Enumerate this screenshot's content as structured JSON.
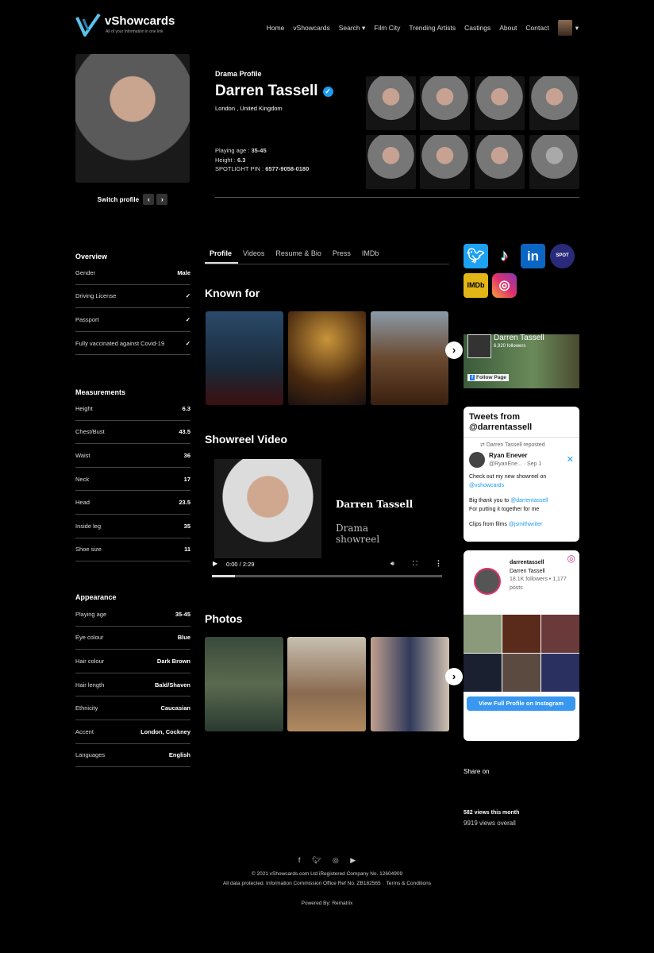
{
  "brand": {
    "name": "vShowcards",
    "tagline": "All of your Information in one link"
  },
  "nav": [
    "Home",
    "vShowcards",
    "Search",
    "Film City",
    "Trending Artists",
    "Castings",
    "About",
    "Contact"
  ],
  "profile": {
    "type": "Drama Profile",
    "name": "Darren Tassell",
    "location": "London , United Kingdom",
    "playing_age_label": "Playing age : ",
    "playing_age": "35-45",
    "height_label": "Height : ",
    "height": "6.3",
    "pin_label": "SPOTLIGHT PIN : ",
    "pin": "6577-9058-0180",
    "switch_label": "Switch profile"
  },
  "tabs": [
    "Profile",
    "Videos",
    "Resume & Bio",
    "Press",
    "IMDb"
  ],
  "overview": {
    "title": "Overview",
    "rows": [
      [
        "Gender",
        "Male"
      ],
      [
        "Driving License",
        "✓"
      ],
      [
        "Passport",
        "✓"
      ],
      [
        "Fully vaccinated against Covid-19",
        "✓"
      ]
    ]
  },
  "measurements": {
    "title": "Measurements",
    "rows": [
      [
        "Height",
        "6.3"
      ],
      [
        "Chest/Bust",
        "43.5"
      ],
      [
        "Waist",
        "36"
      ],
      [
        "Neck",
        "17"
      ],
      [
        "Head",
        "23.5"
      ],
      [
        "Inside leg",
        "35"
      ],
      [
        "Shoe size",
        "11"
      ]
    ]
  },
  "appearance": {
    "title": "Appearance",
    "rows": [
      [
        "Playing age",
        "35-45"
      ],
      [
        "Eye colour",
        "Blue"
      ],
      [
        "Hair colour",
        "Dark Brown"
      ],
      [
        "Hair length",
        "Bald/Shaven"
      ],
      [
        "Ethnicity",
        "Caucasian"
      ],
      [
        "Accent",
        "London, Cockney"
      ],
      [
        "Languages",
        "English"
      ]
    ]
  },
  "known_for": {
    "title": "Known for"
  },
  "showreel": {
    "title": "Showreel Video",
    "overlay_name": "Darren Tassell",
    "overlay_sub": "Drama showreel",
    "time": "0:00 / 2:29",
    "progress": 0.1
  },
  "photos": {
    "title": "Photos"
  },
  "facebook": {
    "name": "Darren Tassell",
    "followers": "6,920 followers",
    "follow": "Follow Page"
  },
  "twitter": {
    "title": "Tweets from @darrentassell",
    "repost": "Darren Tassell reposted",
    "author": "Ryan Enever",
    "handle": "@RyanEne...",
    "date": "· Sep 1",
    "line1": "Check out my new showreel on",
    "link1": "@vshowcards",
    "line2": "Big thank you to",
    "link2": "@darrentassell",
    "line3": "For putting it together for me",
    "line4": "Clips from films",
    "link4": "@jsmithwriter"
  },
  "instagram": {
    "username": "darrentassell",
    "name": "Darren Tassell",
    "stats": "18.1K followers • 1,177 posts",
    "button": "View Full Profile on Instagram"
  },
  "share_label": "Share on",
  "views": {
    "month": "582 views this month",
    "overall": "9919 views overall"
  },
  "footer": {
    "copyright": "© 2021 vShowcards.com Ltd iRegistered Company No. 12604909",
    "data": "All data protected. Information Commission Office Ref No. ZB182565",
    "terms": "Terms & Conditions",
    "powered": "Powered By: Rematrix"
  },
  "colors": {
    "twitter": "#1da1f2",
    "linkedin": "#0a66c2",
    "imdb": "#e2b616",
    "verified": "#1d9bf0",
    "insta_button": "#3897f0"
  }
}
